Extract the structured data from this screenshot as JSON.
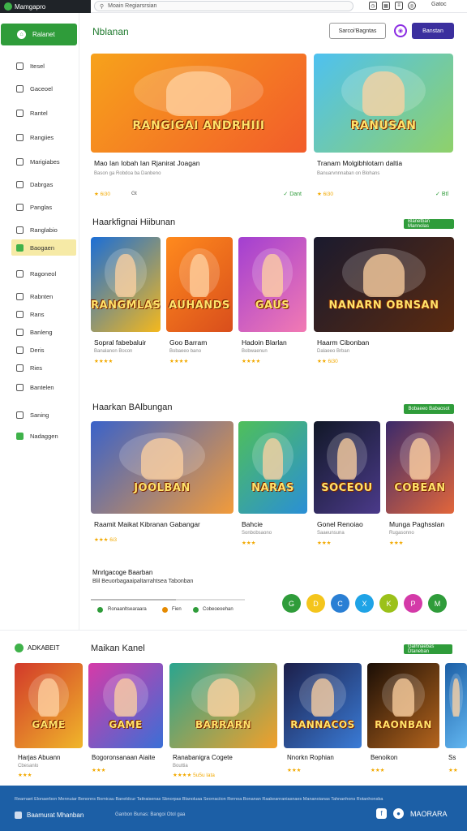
{
  "topbar": {
    "brand": "Mamgapro",
    "search_placeholder": "Moain Regiarsrsian",
    "user_label": "Gatoc"
  },
  "sidebar": {
    "home_label": "Ralanet",
    "items": [
      {
        "label": "Itesel"
      },
      {
        "label": "Gaceoel"
      },
      {
        "label": "Rantel"
      },
      {
        "label": "Rangiies"
      },
      {
        "label": "Marigiabes"
      },
      {
        "label": "Dabrgas"
      },
      {
        "label": "Panglas"
      },
      {
        "label": "Ranglabio"
      },
      {
        "label": "Baogaen"
      },
      {
        "label": "Ragoneol"
      },
      {
        "label": "Rabnten"
      },
      {
        "label": "Rans"
      },
      {
        "label": "Banleng"
      },
      {
        "label": "Deris"
      },
      {
        "label": "Ries"
      },
      {
        "label": "Bantelen"
      },
      {
        "label": "Saning"
      },
      {
        "label": "Nadaggen"
      }
    ]
  },
  "header": {
    "title": "Nblanan",
    "outline_button": "Sarcoi'Bagntas",
    "primary_button": "Banstan"
  },
  "featured": [
    {
      "art_text": "RANGIGAI ANDRHIII",
      "title": "Mao Ian Iobah Ian Rjanirat Joagan",
      "subtitle": "Bason ga Robdoa ba Danbeno",
      "rating": "6i30",
      "meta": "Gt",
      "status": "Dant"
    },
    {
      "art_text": "RANUSAN",
      "title": "Tranam Molgibhlotarn daltia",
      "subtitle": "Banuarvnnnaban on Blohans",
      "rating": "6i30",
      "meta": "",
      "status": "Btl"
    }
  ],
  "section1": {
    "title": "Haarkfignai Hiibunan",
    "badge": "Blanetban Mannolas",
    "cards": [
      {
        "art_text": "RANGMLAS",
        "title": "Sopral fabebaluir",
        "subtitle": "Banalanon Bocon",
        "rating": "★★★★"
      },
      {
        "art_text": "AUHANDS",
        "title": "Goo Barram",
        "subtitle": "Bobaeeo bano",
        "rating": "★★★★"
      },
      {
        "art_text": "GAUS",
        "title": "Hadoin Blarlan",
        "subtitle": "Bobwaenun",
        "rating": "★★★★"
      },
      {
        "art_text": "NANARN OBNSAN",
        "title": "Haarm Cibonban",
        "subtitle": "Dalaeeo Brban",
        "rating": "★★ 6i30"
      }
    ]
  },
  "section2": {
    "title": "Haarkan BAlbungan",
    "badge": "Bobaeeo Babaosot",
    "cards": [
      {
        "art_text": "JOOLBAN",
        "title": "Raamit Maikat Kibranan Gabangar",
        "subtitle": "",
        "rating": "★★★ 6i3"
      },
      {
        "art_text": "NARAS",
        "title": "Bahcie",
        "subtitle": "Sonbobsaono",
        "rating": "★★★"
      },
      {
        "art_text": "SOCEOU",
        "title": "Gonel Renoiao",
        "subtitle": "Saaeunsuna",
        "rating": "★★★"
      },
      {
        "art_text": "COBEAN",
        "title": "Munga Paghsslan",
        "subtitle": "Rugasonno",
        "rating": "★★★"
      }
    ]
  },
  "progress": {
    "title": "Mnrlgacoge Baarban",
    "subtitle": "Blil Beuorbagaaipaltarrahtsea Tabonban",
    "fraction": 0.55,
    "labels": [
      "Ronaanltsearaara",
      "Fien",
      "Cobeoeoehan"
    ]
  },
  "dot_buttons": [
    {
      "icon": "G",
      "color": "#2f9c3a"
    },
    {
      "icon": "D",
      "color": "#f4c51c"
    },
    {
      "icon": "C",
      "color": "#2a7fd4"
    },
    {
      "icon": "X",
      "color": "#1fa3e6"
    },
    {
      "icon": "K",
      "color": "#9bc11a"
    },
    {
      "icon": "P",
      "color": "#d43aa8"
    },
    {
      "icon": "M",
      "color": "#2f9c3a"
    }
  ],
  "bottom": {
    "brand": "ADKABEIT",
    "title": "Maikan Kanel",
    "badge": "Galhnaebas Dtaneban",
    "cards": [
      {
        "art_text": "GAME",
        "title": "Harjas Abuann",
        "subtitle": "Cbesanlo",
        "rating": "★★★"
      },
      {
        "art_text": "GAME",
        "title": "Bogoronsanaan Aiaite",
        "subtitle": "",
        "rating": "★★★"
      },
      {
        "art_text": "BARRARN",
        "title": "Ranabanigra Cogete",
        "subtitle": "Bouttia",
        "rating": "★★★★ 5u5u lata"
      },
      {
        "art_text": "RANNACOS",
        "title": "Nnorkn Rophian",
        "subtitle": "",
        "rating": "★★★"
      },
      {
        "art_text": "RAONBAN",
        "title": "Benoikon",
        "subtitle": "",
        "rating": "★★★"
      },
      {
        "art_text": "",
        "title": "Ss",
        "subtitle": "",
        "rating": "★★"
      }
    ]
  },
  "footer": {
    "links": "Rearnaet Elonaerbon Mennuiar Benonns  Bomicau Baneldcur Tattraisenas  Sbnorpas Blanoluaa Seorraciion  Rernoa Bonanan  Raakeanraniasnaes  Mananoianas  Tahnanhons  Rotanhonsba",
    "brand": "Baamurat Mhanban",
    "copy": "Ganbon Bunas: Bangoi Otol gaa",
    "social_label": "MAORARA"
  }
}
